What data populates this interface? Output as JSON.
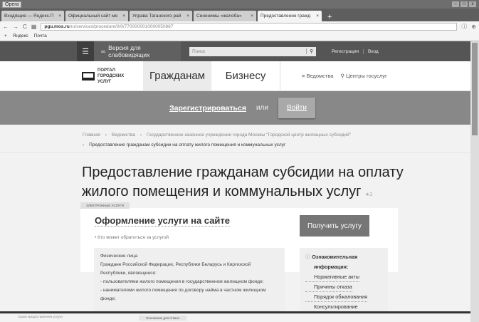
{
  "browser": {
    "app": "Opera",
    "tabs": [
      {
        "label": "Входящие — Яндекс.П"
      },
      {
        "label": "Официальный сайт ме"
      },
      {
        "label": "Управа Таганского рай"
      },
      {
        "label": "Синонимы «жалоба»"
      },
      {
        "label": "Предоставление гражд",
        "active": true
      }
    ],
    "url_domain": "pgu.mos.ru",
    "url_path": "/ru/services/procedure/0/0/7700000010000050887",
    "bookmarks": [
      "Яндекс",
      "Почта"
    ]
  },
  "topbar": {
    "accessible": "Версия для слабовидящих",
    "search_placeholder": "Поиск",
    "register": "Регистрация",
    "login": "Вход"
  },
  "nav": {
    "logo": [
      "ПОРТАЛ",
      "ГОРОДСКИХ",
      "УСЛУГ"
    ],
    "tabs": [
      "Гражданам",
      "Бизнесу"
    ],
    "links": [
      "Ведомства",
      "Центры госуслуг"
    ]
  },
  "band": {
    "register": "Зарегистрироваться",
    "or": "или",
    "login": "Войти"
  },
  "breadcrumbs": [
    "Главная",
    "Ведомства",
    "Государственное казенное учреждение города Москвы \"Городской центр жилищных субсидий\"",
    "Предоставление гражданам субсидии на оплату жилого помещения и коммунальных услуг"
  ],
  "title_line1": "Предоставление гражданам субсидии на оплату",
  "title_line2": "жилого помещения и коммунальных услуг",
  "rating": "3",
  "card": {
    "badge": "ЭЛЕКТРОННЫЕ УСЛУГИ",
    "heading": "Оформление услуги на сайте",
    "who": "Кто может обратиться за услугой",
    "button": "Получить услугу",
    "applicants": [
      "Физические лица",
      "Граждане Российской Федерации, Республики Беларусь и Киргизской Республики, являющиеся:",
      "- пользователями жилого помещения в государственном жилищном фонде;",
      "- нанимателями жилого помещения по договору найма в частном жилищном фонде;"
    ],
    "info_heading": "Ознакомительная информация:",
    "info_links": [
      "Нормативные акты",
      "Причины отказа",
      "Порядок обжалования",
      "Консультирование"
    ]
  },
  "overlay": {
    "left": "Сроки предоставления услуги",
    "tab": "Основание для отказа"
  }
}
